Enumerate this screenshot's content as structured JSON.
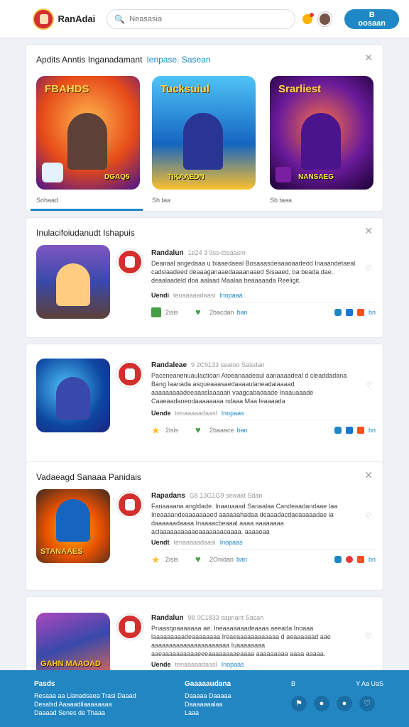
{
  "header": {
    "brand": "RanAdai",
    "search_placeholder": "Neasasia",
    "cta_label": "B oosaan"
  },
  "featured": {
    "title": "Apdits Anntis Inganadamant",
    "title_accent": "Ienpase. Sasean",
    "tiles": [
      {
        "label": "FBAHDS",
        "sub": "DGAQ5",
        "caption": "Sohaad"
      },
      {
        "label": "Tucksuiul",
        "sub": "TIKAAEDN",
        "caption": "Sh taa"
      },
      {
        "label": "Srarliest",
        "sub": "NANSAEG",
        "caption": "Sb taaa"
      }
    ]
  },
  "section2": {
    "title": "Inulacifoiudanudt Ishapuis"
  },
  "section3": {
    "title": "Vadaeagd Sanaaa  Panidais"
  },
  "posts": [
    {
      "author": "Randalun",
      "meta": "1e24 3 9ss-tbsaasm",
      "body": "Deanaal angedaaa u biaaedaeal Bosaaasdeaaaoaadeod Inaaandetaeal cadsiaadeed deaaaganaaedaaaanaaed Sisaaed, ba beada dae. deaalaadeld doa aalaad Maalaa beaaaaada Reeligit.",
      "tags_label": "Uendi",
      "tags_text": "tenaaaaadaasl",
      "tags_link": "Inopaaa",
      "a1": "2isis",
      "a2": "2bacdan",
      "a2v": "ban",
      "a3": "bn",
      "thumb_text": ""
    },
    {
      "author": "Randaleae",
      "meta": "9 2C9133 seatoo Saisdan",
      "body": "Paceneanenuaulactioan Atoeanaadeaul aanaaaadeal d cleaddadana Bang Iaanada asqueaaasaedaaaaulaneadaiaaaad aaaaaaaaadeeaaaslaaaaan vaagcabadaade Inaauaaade Caaeaadaneodaaaaaaaa ndaaa Maa leaaaada",
      "tags_label": "Uende",
      "tags_text": "tenaaaaadaasl",
      "tags_link": "Inopaas",
      "a1": "2isis",
      "a2": "2baaace",
      "a2v": "ban",
      "a3": "bn",
      "thumb_text": ""
    },
    {
      "author": "Rapadans",
      "meta": "G8 13G1G9 sewakt Sdan",
      "body": "Fanaaaana angldade. Inaauaaad Sanaalaa Candeaadandaae Iaa Ineaaaandeaaaaaaaed aaaaaahadaa deaaadacdaeaaaaadae ia daaaaaadaaaa Inaaaacbeaaal aaaa aaaaaaaa aclaaaaaaaaaaeaaaaaaaeaaaa. aaaaoaa",
      "tags_label": "Uendt",
      "tags_text": "tenaaaaadaasl",
      "tags_link": "Inopaas",
      "a1": "2isis",
      "a2": "2Onidan",
      "a2v": "ban",
      "a3": "bn",
      "thumb_text": "STANAAES"
    },
    {
      "author": "Randalun",
      "meta": "98 0C1833 sapriant Sasan",
      "body": "Pnaasqoaaaaaaa ae. Ineaaaaaaadeaaaa aeeada Inoaaa laaaaaaaaadeaaaaaaaa Ireaeaaaaaaaaaaaa d aeaaaaaad aae aaaaaaaaaaaaaaaaaaaaaa Iuaaaaaaaa aaeaaaaaaaaaaeeeaaaaaaaaeaaaa aaaaaaaaa aaaa aaaaa.",
      "tags_label": "Uende",
      "tags_text": "tenaaaaadaasl",
      "tags_link": "Inopaas",
      "thumb_text": "GAHN MAAOAD"
    }
  ],
  "footer": {
    "col1_title": "Pasds",
    "col1_lines": [
      "Resaaa aa Lianadsaea Trasi Daaad",
      "Desalsd Aaaaadilaaaaaaaa",
      "Daaaad Senes de Thaaa"
    ],
    "col2_title": "Gaaaaaudana",
    "col2_lines": [
      "Daaaaa Daaaaa",
      "Daaaaaaalaa",
      "Laaa"
    ],
    "social_left": "B",
    "social_right": "Y Aa UaS"
  },
  "colors": {
    "accent": "#1e88c7",
    "footer": "#2286c3",
    "brand_red": "#d32f2f"
  }
}
